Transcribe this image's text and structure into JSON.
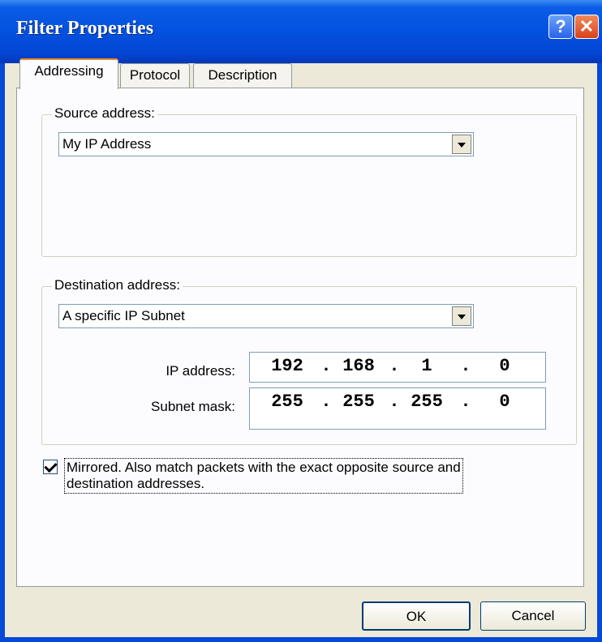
{
  "window": {
    "title": "Filter Properties",
    "help_label": "?",
    "close_label": "✕"
  },
  "tabs": [
    {
      "label": "Addressing",
      "active": true
    },
    {
      "label": "Protocol",
      "active": false
    },
    {
      "label": "Description",
      "active": false
    }
  ],
  "source": {
    "group_label": "Source address:",
    "selected": "My IP Address"
  },
  "destination": {
    "group_label": "Destination address:",
    "selected": "A specific IP Subnet",
    "ip_label": "IP address:",
    "ip_octets": [
      "192",
      "168",
      "1",
      "0"
    ],
    "mask_label": "Subnet mask:",
    "mask_octets": [
      "255",
      "255",
      "255",
      "0"
    ]
  },
  "mirrored": {
    "checked": true,
    "label_line1": "Mirrored. Also match packets with the exact opposite source and",
    "label_line2": "destination addresses."
  },
  "buttons": {
    "ok": "OK",
    "cancel": "Cancel"
  },
  "colors": {
    "titlebar": "#0451df",
    "dialog_bg": "#ece9d8",
    "panel_bg": "#fcfcfe"
  }
}
